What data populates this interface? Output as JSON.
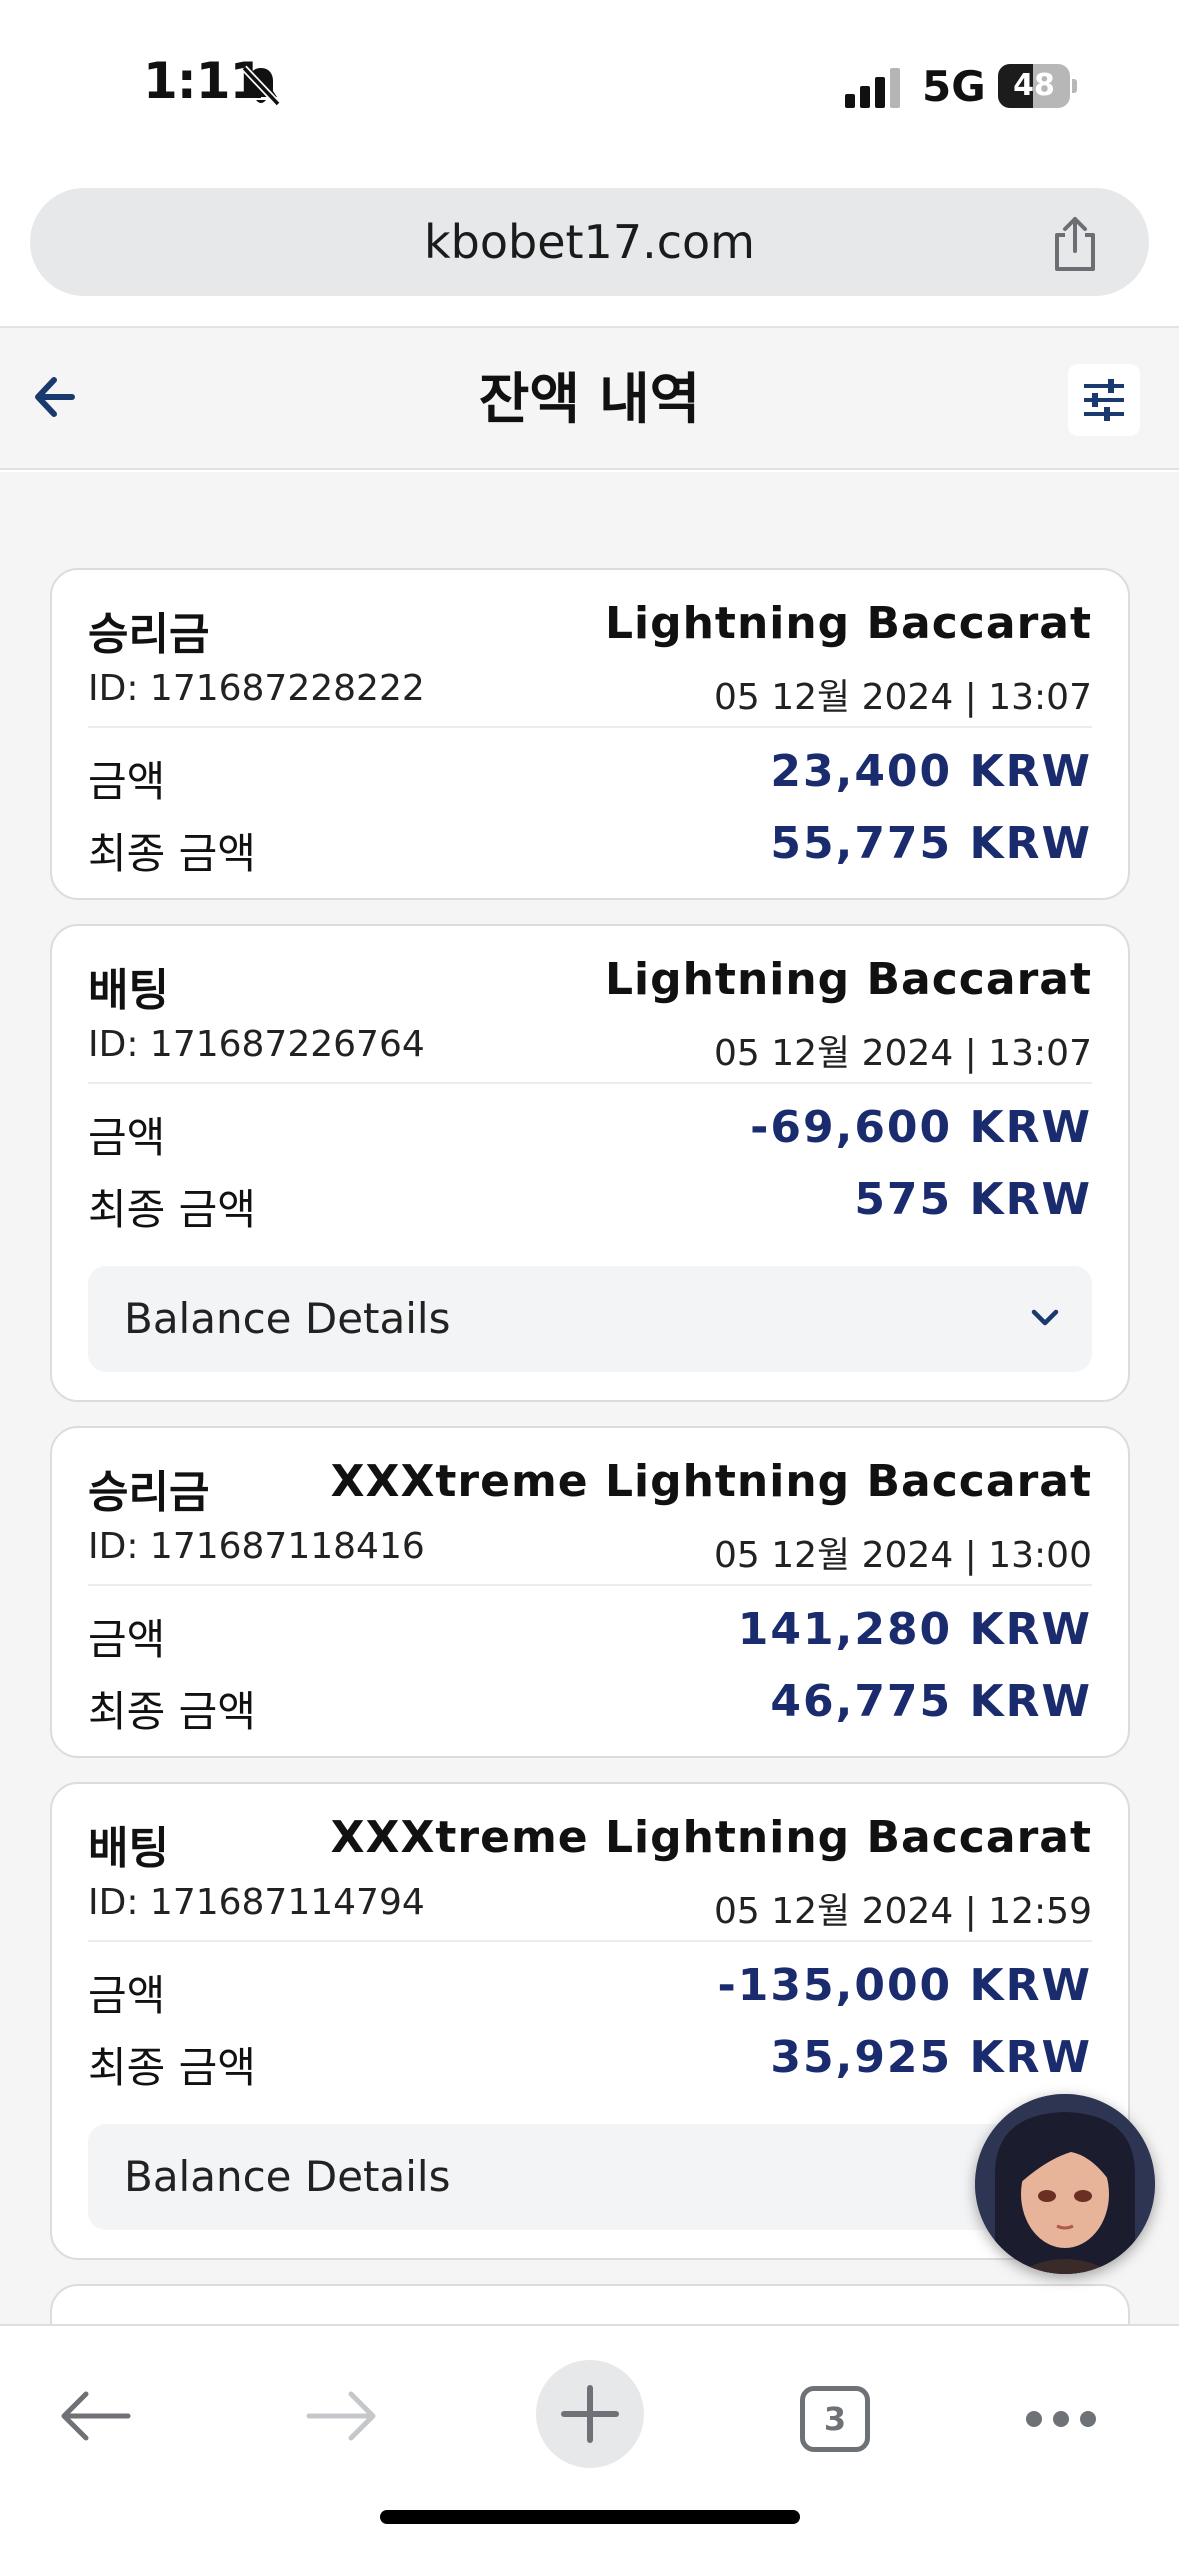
{
  "status_bar": {
    "time": "1:11",
    "network": "5G",
    "battery_level": "48",
    "battery_fraction": 0.48
  },
  "browser": {
    "url": "kbobet17.com",
    "tab_count": "3"
  },
  "header": {
    "title": "잔액 내역"
  },
  "colors": {
    "amount_text": "#1a2c6e",
    "card_border": "#dcdcdc",
    "page_background": "#f5f5f5"
  },
  "transactions": [
    {
      "type": "승리금",
      "game": "Lightning Baccarat",
      "id": "ID: 171687228222",
      "datetime": "05 12월 2024 | 13:07",
      "amount_label": "금액",
      "amount": "23,400 KRW",
      "final_label": "최종 금액",
      "final_amount": "55,775 KRW"
    },
    {
      "type": "배팅",
      "game": "Lightning Baccarat",
      "id": "ID: 171687226764",
      "datetime": "05 12월 2024 | 13:07",
      "amount_label": "금액",
      "amount": "-69,600 KRW",
      "final_label": "최종 금액",
      "final_amount": "575 KRW",
      "details_label": "Balance Details"
    },
    {
      "type": "승리금",
      "game": "XXXtreme Lightning Baccarat",
      "id": "ID: 171687118416",
      "datetime": "05 12월 2024 | 13:00",
      "amount_label": "금액",
      "amount": "141,280 KRW",
      "final_label": "최종 금액",
      "final_amount": "46,775 KRW"
    },
    {
      "type": "배팅",
      "game": "XXXtreme Lightning Baccarat",
      "id": "ID: 171687114794",
      "datetime": "05 12월 2024 | 12:59",
      "amount_label": "금액",
      "amount": "-135,000 KRW",
      "final_label": "최종 금액",
      "final_amount": "35,925 KRW",
      "details_label": "Balance Details"
    }
  ],
  "icons": {
    "status_bell": "bell-slash-icon",
    "status_signal": "cellular-signal-icon",
    "share": "share-icon",
    "back": "arrow-left-icon",
    "filter": "sliders-icon",
    "details": "chevron-down-icon",
    "toolbar_back": "arrow-left-icon",
    "toolbar_forward": "arrow-right-icon",
    "new_tab": "plus-icon",
    "tabs": "tabs-icon",
    "more": "ellipsis-icon"
  }
}
